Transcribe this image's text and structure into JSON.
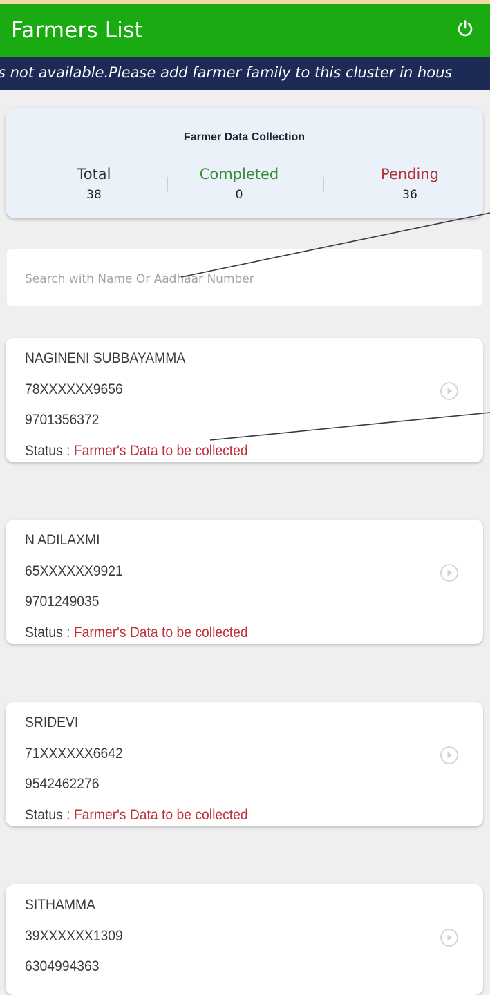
{
  "app": {
    "title": "Farmers List",
    "power_icon": "power-icon"
  },
  "ticker": {
    "text": "s not available.Please add farmer family to this cluster in hous"
  },
  "summary": {
    "title": "Farmer Data Collection",
    "total_label": "Total",
    "total_value": "38",
    "completed_label": "Completed",
    "completed_value": "0",
    "pending_label": "Pending",
    "pending_value": "36"
  },
  "search": {
    "placeholder": "Search with Name Or Aadhaar Number",
    "value": ""
  },
  "status_prefix": "Status : ",
  "farmers": [
    {
      "name": "NAGINENI SUBBAYAMMA",
      "aadhaar": "78XXXXXX9656",
      "phone": "9701356372",
      "status": "Farmer's Data to be collected"
    },
    {
      "name": "N ADILAXMI",
      "aadhaar": "65XXXXXX9921",
      "phone": "9701249035",
      "status": "Farmer's Data to be collected"
    },
    {
      "name": "SRIDEVI",
      "aadhaar": "71XXXXXX6642",
      "phone": "9542462276",
      "status": "Farmer's Data to be collected"
    },
    {
      "name": "SITHAMMA",
      "aadhaar": "39XXXXXX1309",
      "phone": "6304994363",
      "status": ""
    }
  ],
  "colors": {
    "appbar": "#1aab12",
    "ticker_bg": "#1c2a55",
    "completed": "#3d8b3d",
    "pending": "#b0313a",
    "status": "#c0303a"
  },
  "icons": [
    "power-icon",
    "play-circle-icon"
  ]
}
